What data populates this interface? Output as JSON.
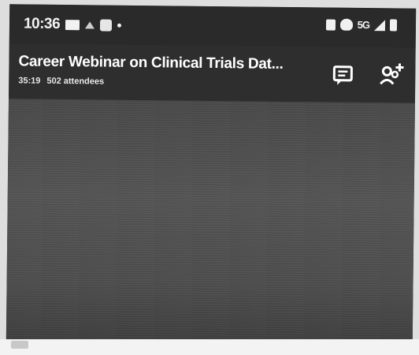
{
  "status_bar": {
    "time": "10:36",
    "left_icons": [
      "mail-icon",
      "caret-icon",
      "teams-status-icon",
      "dot-icon"
    ],
    "right_icons": [
      "nfc-icon",
      "alarm-icon",
      "network-icon",
      "signal-icon",
      "battery-icon"
    ],
    "network_text": "5G"
  },
  "meeting": {
    "title": "Career Webinar on Clinical Trials Dat...",
    "elapsed": "35:19",
    "attendees": "502 attendees"
  },
  "actions": {
    "chat_icon": "chat-icon",
    "participants_icon": "add-participant-icon"
  },
  "colors": {
    "status_bar": "#2a2a2a",
    "header": "#2e2e2e",
    "video_area": "#4f4f4f",
    "text": "#ffffff"
  }
}
